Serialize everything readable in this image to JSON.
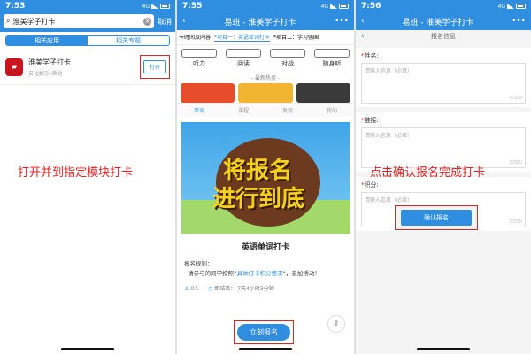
{
  "panel1": {
    "time": "7:53",
    "net": "4G",
    "search_value": "淮美学子打卡",
    "cancel_label": "取消",
    "tabs": [
      "相关应用",
      "相关专题"
    ],
    "app": {
      "title": "淮美学子打卡",
      "sub": "文化娱乐-活动",
      "open_label": "打开"
    },
    "instruction": "打开并到指定模块打卡"
  },
  "panel2": {
    "time": "7:55",
    "net": "4G",
    "title": "易班 - 淮美学子打卡",
    "tabs": [
      "卡时间及内容",
      "*项目一：英语单词打卡",
      "*项目二：学习强国"
    ],
    "icons": [
      "听力",
      "阅读",
      "对战",
      "随身听"
    ],
    "hot_title": "- 最新热卖 -",
    "bottom_nav": [
      "单词",
      "课程",
      "发现",
      "我的"
    ],
    "poster_line1": "将报名",
    "poster_line2": "进行到底",
    "card_title": "英语单词打卡",
    "rule_label": "报名规则：",
    "rule_text_a": "请参与的同学按照“",
    "rule_link": "具体打卡积分要求",
    "rule_text_b": "”，参加活动！",
    "count": "0人",
    "deadline_label": "距结束：",
    "deadline_value": "7天4小时3分钟",
    "signup_label": "立刻报名"
  },
  "panel3": {
    "time": "7:56",
    "net": "4G",
    "title": "易班 - 淮美学子打卡",
    "sub_title": "报名信息",
    "fields": [
      {
        "label": "姓名:",
        "placeholder": "请输入信息（必填）",
        "count": "0/300"
      },
      {
        "label": "链接:",
        "placeholder": "请输入信息（必填）",
        "count": "0/300"
      },
      {
        "label": "积分:",
        "placeholder": "请输入信息（必填）",
        "count": "0/300"
      }
    ],
    "instruction": "点击确认报名完成打卡",
    "confirm_label": "确认报名"
  },
  "colors": {
    "accent": "#2f8ee0",
    "highlight": "#e02424"
  }
}
